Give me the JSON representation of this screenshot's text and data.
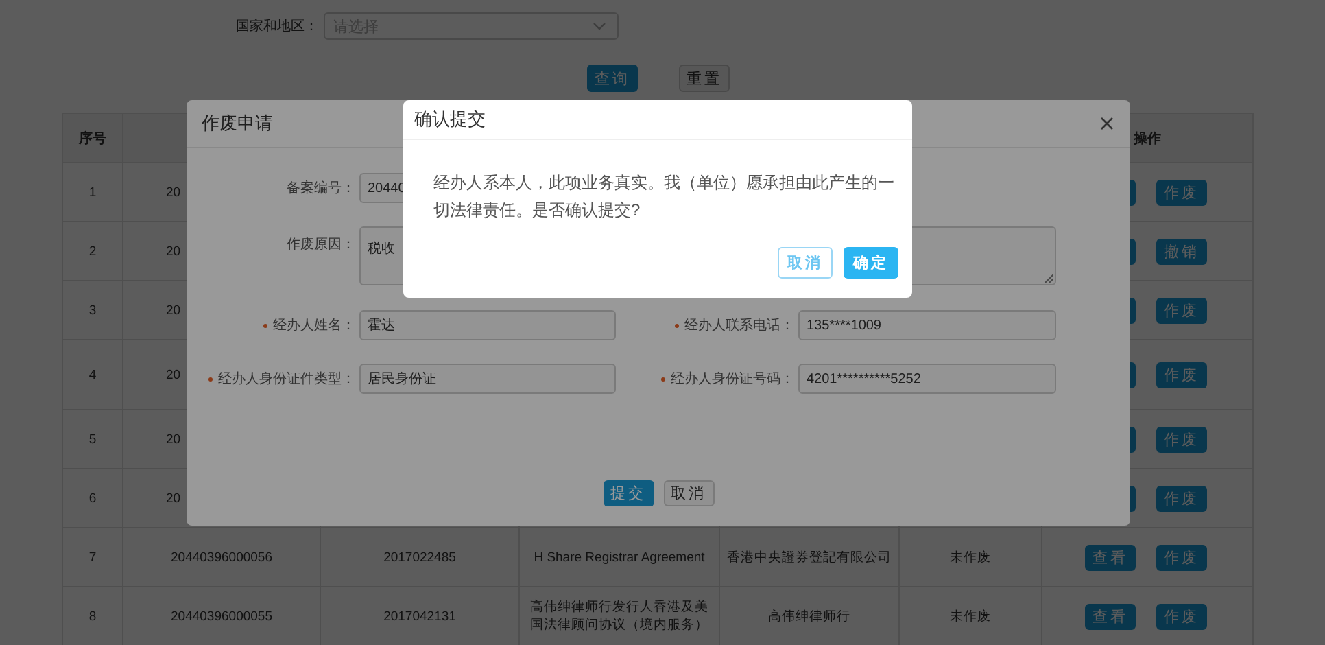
{
  "filter": {
    "label": "国家和地区：",
    "select": {
      "placeholder": "请选择"
    }
  },
  "filter_buttons": [
    {
      "label": "查询",
      "kind": "primary"
    },
    {
      "label": "重置",
      "kind": "default"
    }
  ],
  "table": {
    "columns": [
      "序号",
      "操作"
    ],
    "rows": [
      {
        "cells": [
          "1",
          "20"
        ],
        "actions": [
          {
            "kind": "covered"
          },
          {
            "kind": "button",
            "label": "作废"
          }
        ]
      },
      {
        "cells": [
          "2",
          "20"
        ],
        "actions": [
          {
            "kind": "covered"
          },
          {
            "kind": "button",
            "label": "撤销"
          }
        ]
      },
      {
        "cells": [
          "3",
          "20"
        ],
        "actions": [
          {
            "kind": "covered"
          },
          {
            "kind": "button",
            "label": "作废"
          }
        ]
      },
      {
        "cells": [
          "4",
          "20"
        ],
        "actions": [
          {
            "kind": "covered"
          },
          {
            "kind": "button",
            "label": "作废"
          }
        ]
      },
      {
        "cells": [
          "5",
          "20"
        ],
        "actions": [
          {
            "kind": "covered"
          },
          {
            "kind": "button",
            "label": "作废"
          }
        ]
      },
      {
        "cells": [
          "6",
          "20"
        ],
        "actions": [
          {
            "kind": "covered"
          },
          {
            "kind": "button",
            "label": "作废"
          }
        ]
      },
      {
        "cells": [
          "7",
          "20440396000056",
          "2017022485",
          "H Share Registrar Agreement",
          "香港中央證券登記有限公司",
          "未作废"
        ],
        "actions": [
          {
            "kind": "button",
            "label": "查看"
          },
          {
            "kind": "button",
            "label": "作废"
          }
        ]
      },
      {
        "cells": [
          "8",
          "20440396000055",
          "2017042131",
          "高伟绅律师行发行人香港及美国法律顾问协议（境内服务）",
          "高伟绅律师行",
          "未作废"
        ],
        "actions": [
          {
            "kind": "button",
            "label": "查看"
          },
          {
            "kind": "button",
            "label": "作废"
          }
        ]
      }
    ]
  },
  "void_dialog": {
    "title": "作废申请",
    "fields": [
      {
        "kind": "input",
        "label": "备案编号：",
        "value": "20440",
        "required": false
      },
      {
        "kind": "textarea",
        "label": "作废原因：",
        "value": "税收",
        "required": false
      },
      {
        "kind": "input",
        "label": "经办人姓名：",
        "value": "霍达",
        "required": true
      },
      {
        "kind": "input",
        "label": "经办人联系电话：",
        "value": "135****1009",
        "required": true
      },
      {
        "kind": "input",
        "label": "经办人身份证件类型：",
        "value": "居民身份证",
        "required": true
      },
      {
        "kind": "input",
        "label": "经办人身份证号码：",
        "value": "4201**********5252",
        "required": true
      }
    ],
    "buttons": [
      {
        "label": "提交",
        "kind": "primary"
      },
      {
        "label": "取消",
        "kind": "default"
      }
    ]
  },
  "confirm_dialog": {
    "title": "确认提交",
    "message": "经办人系本人，此项业务真实。我（单位）愿承担由此产生的一切法律责任。是否确认提交?",
    "buttons": [
      {
        "label": "取消",
        "kind": "default"
      },
      {
        "label": "确定",
        "kind": "primary"
      }
    ]
  }
}
